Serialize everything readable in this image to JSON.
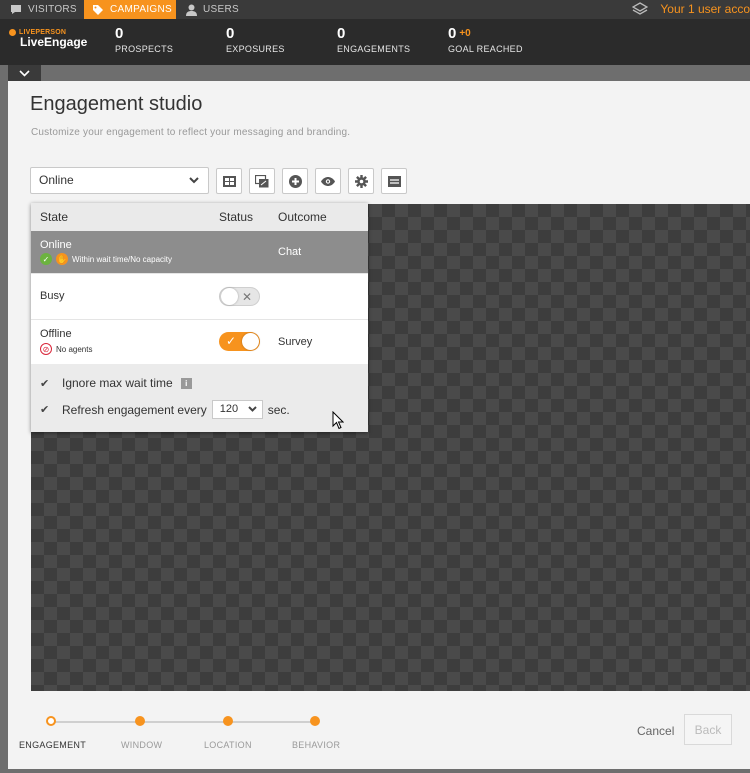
{
  "topnav": {
    "tabs": [
      {
        "label": "VISITORS",
        "icon": "chat-bubble-icon",
        "active": false
      },
      {
        "label": "CAMPAIGNS",
        "icon": "tag-icon",
        "active": true
      },
      {
        "label": "USERS",
        "icon": "user-icon",
        "active": false
      }
    ],
    "notice": "Your 1 user acco"
  },
  "brand": {
    "small": "LIVEPERSON",
    "name": "LiveEngage"
  },
  "stats": [
    {
      "value": "0",
      "label": "PROSPECTS"
    },
    {
      "value": "0",
      "label": "EXPOSURES"
    },
    {
      "value": "0",
      "label": "ENGAGEMENTS"
    },
    {
      "value": "0",
      "delta": "+0",
      "label": "GOAL REACHED"
    }
  ],
  "studio": {
    "title": "Engagement studio",
    "subtitle": "Customize your engagement to reflect your messaging and branding.",
    "state_select": "Online",
    "toolbar_icons": [
      "layout-icon",
      "window-resize-icon",
      "add-icon",
      "preview-eye-icon",
      "settings-gear-icon",
      "list-icon"
    ]
  },
  "states_panel": {
    "headers": {
      "state": "State",
      "status": "Status",
      "outcome": "Outcome"
    },
    "rows": [
      {
        "name": "Online",
        "sub": "Within wait time/No capacity",
        "outcome": "Chat",
        "toggle": null,
        "selected": true
      },
      {
        "name": "Busy",
        "sub": "",
        "outcome": "",
        "toggle": "off",
        "selected": false
      },
      {
        "name": "Offline",
        "sub": "No agents",
        "outcome": "Survey",
        "toggle": "on",
        "selected": false
      }
    ],
    "ignore_wait_label": "Ignore max wait time",
    "refresh_prefix": "Refresh engagement every",
    "refresh_value": "120",
    "refresh_suffix": "sec."
  },
  "wizard": {
    "steps": [
      "ENGAGEMENT",
      "WINDOW",
      "LOCATION",
      "BEHAVIOR"
    ],
    "current": "ENGAGEMENT"
  },
  "actions": {
    "cancel": "Cancel",
    "back": "Back"
  },
  "colors": {
    "accent": "#f7931e",
    "topbar": "#2b2b2b",
    "canvas": "#4a4a4a"
  }
}
